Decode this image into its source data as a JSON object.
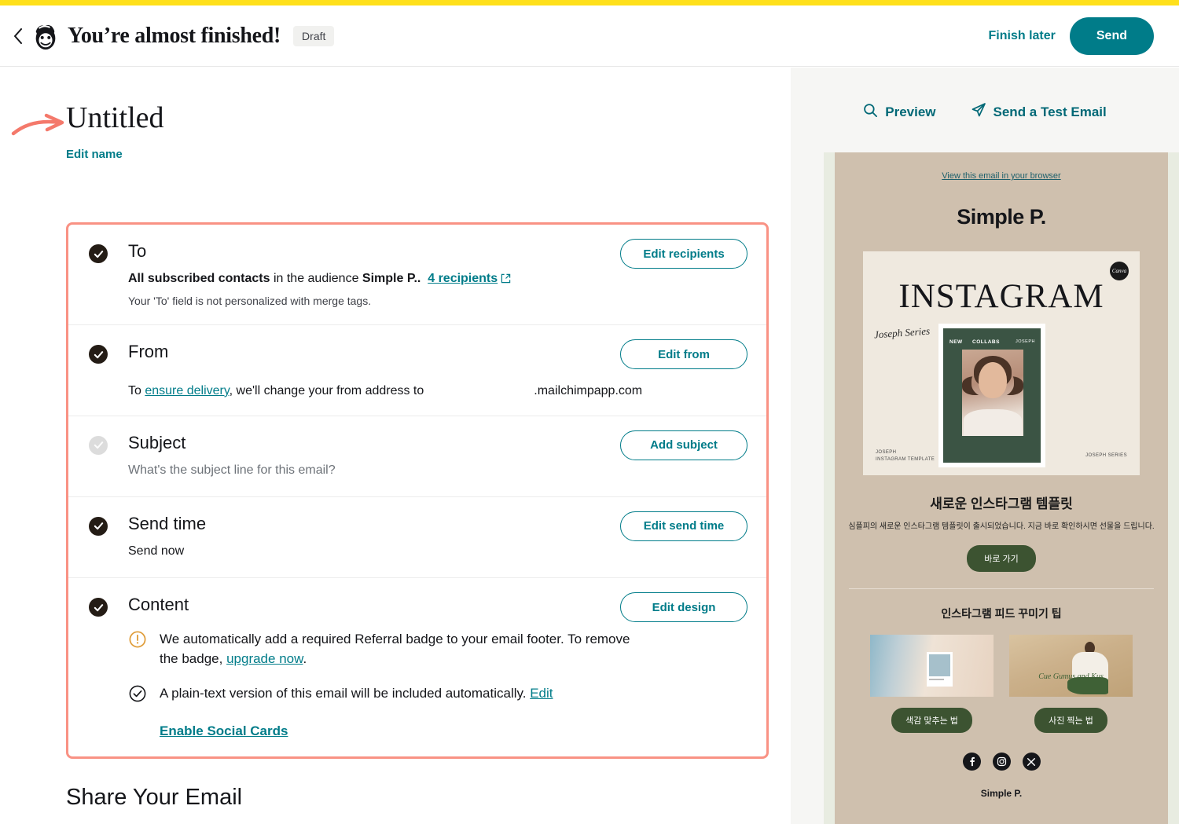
{
  "header": {
    "back_icon": "chevron-left-icon",
    "logo_icon": "mailchimp-freddie-logo",
    "title": "You’re almost finished!",
    "status_badge": "Draft",
    "finish_later_label": "Finish later",
    "send_label": "Send",
    "accent_color": "#007c89",
    "brand_bar_color": "#ffe01b"
  },
  "campaign": {
    "name": "Untitled",
    "edit_name_label": "Edit name",
    "annotation_arrow_color": "#f4796b"
  },
  "checklist": {
    "border_color": "#f99284",
    "rows": [
      {
        "id": "to",
        "title": "To",
        "complete": true,
        "button": "Edit recipients",
        "detail_bold": "All subscribed contacts",
        "detail_mid": " in the audience ",
        "detail_audience": "Simple P..",
        "detail_link": "4 recipients",
        "note": "Your 'To' field is not personalized with merge tags."
      },
      {
        "id": "from",
        "title": "From",
        "complete": true,
        "button": "Edit from",
        "line_pre": "To ",
        "line_link": "ensure delivery",
        "line_mid": ", we'll change your from address to",
        "line_domain": ".mailchimpapp.com"
      },
      {
        "id": "subject",
        "title": "Subject",
        "complete": false,
        "button": "Add subject",
        "placeholder": "What's the subject line for this email?"
      },
      {
        "id": "send-time",
        "title": "Send time",
        "complete": true,
        "button": "Edit send time",
        "value": "Send now"
      },
      {
        "id": "content",
        "title": "Content",
        "complete": true,
        "button": "Edit design",
        "warning_icon": "alert-circle-icon",
        "warning_text_a": "We automatically add a required Referral badge to your email footer. To remove the badge, ",
        "warning_link": "upgrade now",
        "warning_text_b": ".",
        "plaintext_icon": "check-circle-icon",
        "plaintext_text": "A plain-text version of this email will be included automatically. ",
        "plaintext_link": "Edit",
        "social_cards_link": "Enable Social Cards"
      }
    ]
  },
  "share_section": {
    "title": "Share Your Email"
  },
  "preview": {
    "preview_label": "Preview",
    "preview_icon": "search-icon",
    "test_email_label": "Send a Test Email",
    "test_email_icon": "paper-plane-icon",
    "frame_color": "#e8ece1",
    "email_bg": "#cfc0ae"
  },
  "email": {
    "view_in_browser": "View this email in your browser",
    "brand": "Simple P.",
    "hero": {
      "canva_badge": "Canva",
      "word": "INSTAGRAM",
      "script": "Joseph Series",
      "poster_new": "NEW",
      "poster_collabs": "COLLABS",
      "poster_joseph": "JOSEPH",
      "credit_left_1": "JOSEPH",
      "credit_left_2": "INSTAGRAM TEMPLATE",
      "credit_right": "JOSEPH SERIES"
    },
    "headline": "새로운 인스타그램 템플릿",
    "subline": "심플피의 새로운 인스타그램 템플릿이 출시되었습니다. 지금 바로 확인하시면 선물을 드립니다.",
    "cta": "바로 가기",
    "tips_heading": "인스타그램 피드 꾸미기 팁",
    "tips": [
      {
        "button": "색감 맞추는 법"
      },
      {
        "button": "사진 찍는 법",
        "caption": "Cue Gumus and Kus"
      }
    ],
    "socials": [
      "facebook-icon",
      "instagram-icon",
      "x-twitter-icon"
    ],
    "footer_brand": "Simple P."
  }
}
